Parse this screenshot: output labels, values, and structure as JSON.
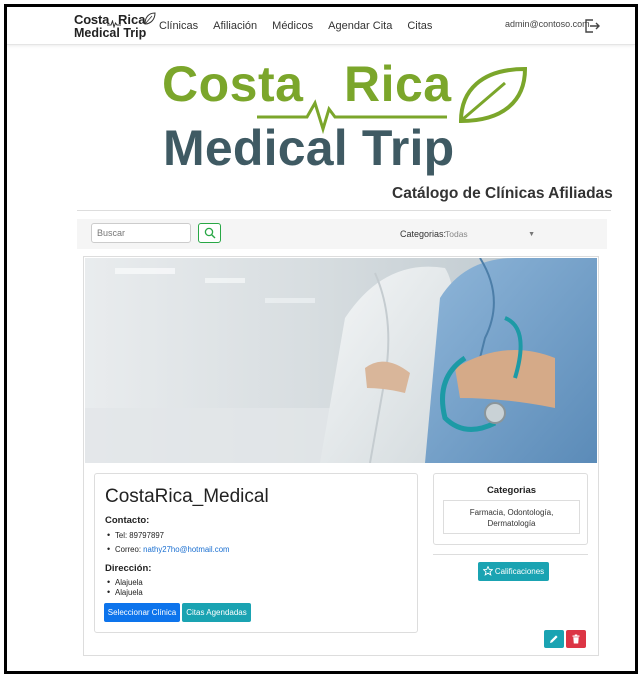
{
  "navbar": {
    "brand_line1": "Costa",
    "brand_line1b": "Rica",
    "brand_line2": "Medical Trip",
    "links": [
      "Clínicas",
      "Afiliación",
      "Médicos",
      "Agendar Cita",
      "Citas"
    ],
    "user_email": "admin@contoso.com",
    "logout_icon": "logout-icon"
  },
  "logo": {
    "word1": "Costa",
    "word2": "Rica",
    "word3": "Medical Trip"
  },
  "catalog_title": "Catálogo de Clínicas Afiliadas",
  "search": {
    "placeholder": "Buscar",
    "value": "",
    "icon": "search-icon",
    "category_label": "Categorias:",
    "category_selected": "Todas"
  },
  "clinic": {
    "name": "CostaRica_Medical",
    "contact_label": "Contacto:",
    "tel": "Tel: 89797897",
    "email_prefix": "Correo: ",
    "email": "nathy27ho@hotmail.com",
    "address_label": "Dirección:",
    "address": [
      "Alajuela",
      "Alajuela"
    ],
    "select_button": "Seleccionar Clínica",
    "appointments_button": "Citas Agendadas",
    "categories_title": "Categorias",
    "categories_line1": "Farmacia, Odontología,",
    "categories_line2": "Dermatología",
    "ratings_button": "Calificaciones"
  },
  "colors": {
    "logo_green": "#7ba62b",
    "logo_slate": "#3f5a63",
    "primary": "#0d74ec",
    "info": "#1aa3b2",
    "danger": "#dc3545",
    "search_border": "#28a745"
  }
}
